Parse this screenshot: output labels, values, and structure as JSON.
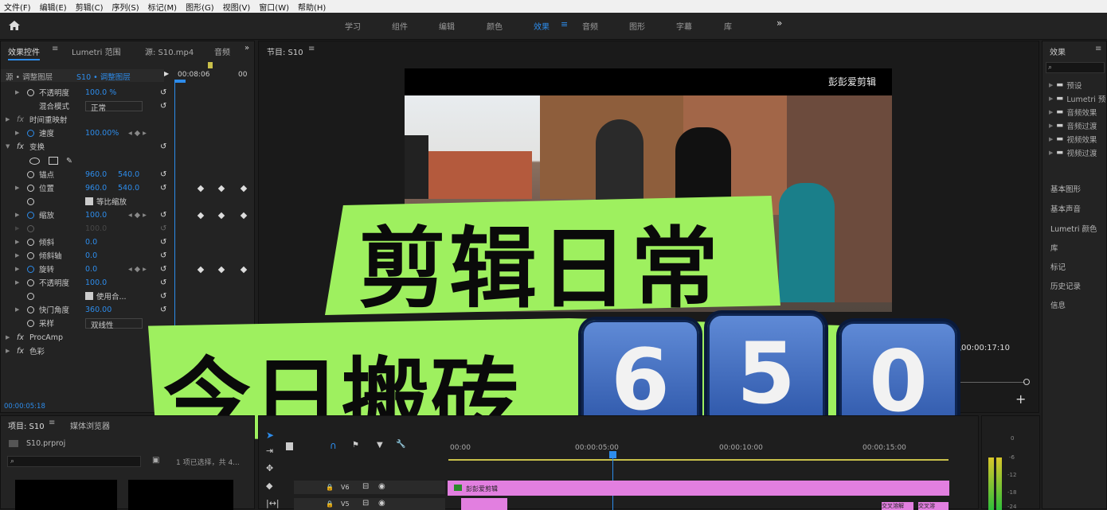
{
  "menu": [
    "文件(F)",
    "编辑(E)",
    "剪辑(C)",
    "序列(S)",
    "标记(M)",
    "图形(G)",
    "视图(V)",
    "窗口(W)",
    "帮助(H)"
  ],
  "workspaces": {
    "items": [
      "学习",
      "组件",
      "编辑",
      "颜色",
      "效果",
      "音频",
      "图形",
      "字幕",
      "库"
    ],
    "active": "效果",
    "more": "»"
  },
  "effect_controls": {
    "tabs": [
      "效果控件",
      "Lumetri 范围",
      "源: S10.mp4",
      "音频"
    ],
    "source_sel": "源 • 调整图层",
    "seq_sel": "S10 • 调整图层",
    "time_start": "00:08:06",
    "time_end": "00",
    "timecode": "00:00:05:18",
    "rows": [
      {
        "label": "不透明度",
        "v1": "100.0 %"
      },
      {
        "label": "混合模式",
        "v1": "正常"
      },
      {
        "label": "时间重映射",
        "v1": ""
      },
      {
        "label": "速度",
        "v1": "100.00%"
      },
      {
        "label": "变换",
        "v1": ""
      },
      {
        "label": "锚点",
        "v1": "960.0",
        "v2": "540.0"
      },
      {
        "label": "位置",
        "v1": "960.0",
        "v2": "540.0"
      },
      {
        "label": "等比缩放",
        "v1": ""
      },
      {
        "label": "缩放",
        "v1": "100.0"
      },
      {
        "label": "",
        "v1": "100.0"
      },
      {
        "label": "倾斜",
        "v1": "0.0"
      },
      {
        "label": "倾斜轴",
        "v1": "0.0"
      },
      {
        "label": "旋转",
        "v1": "0.0"
      },
      {
        "label": "不透明度",
        "v1": "100.0"
      },
      {
        "label": "使用合...",
        "v1": ""
      },
      {
        "label": "快门角度",
        "v1": "360.00"
      },
      {
        "label": "采样",
        "v1": "双线性"
      },
      {
        "label": "ProcAmp",
        "v1": ""
      },
      {
        "label": "色彩",
        "v1": ""
      }
    ]
  },
  "program": {
    "title": "节目: S10",
    "timecode": "00:00:17:10"
  },
  "video_overlay": {
    "watermark": "彭彭爱剪辑",
    "headline1": "剪辑日常",
    "headline2": "今日搬砖",
    "digits": [
      "6",
      "5",
      "0"
    ]
  },
  "effects_panel": {
    "title": "效果",
    "items": [
      "预设",
      "Lumetri 预",
      "音频效果",
      "音频过渡",
      "视频效果",
      "视频过渡"
    ],
    "sections": [
      "基本图形",
      "基本声音",
      "Lumetri 颜色",
      "库",
      "标记",
      "历史记录",
      "信息"
    ]
  },
  "project": {
    "tabs": [
      "项目: S10",
      "媒体浏览器"
    ],
    "file": "S10.prproj",
    "status": "1 项已选择，共 4..."
  },
  "timeline": {
    "ruler": [
      "00:00",
      "00:00:05:00",
      "00:00:10:00",
      "00:00:15:00"
    ],
    "tracks": [
      "V6",
      "V5"
    ],
    "clip1": "彭彭爱剪辑",
    "clip2a": "交叉溶解",
    "clip2b": "交叉溶"
  },
  "meter": [
    "0",
    "-6",
    "-12",
    "-18",
    "-24"
  ],
  "colors": {
    "accent": "#2d8ceb",
    "green_box": "#9ef05f",
    "clip": "#e27fe0"
  }
}
